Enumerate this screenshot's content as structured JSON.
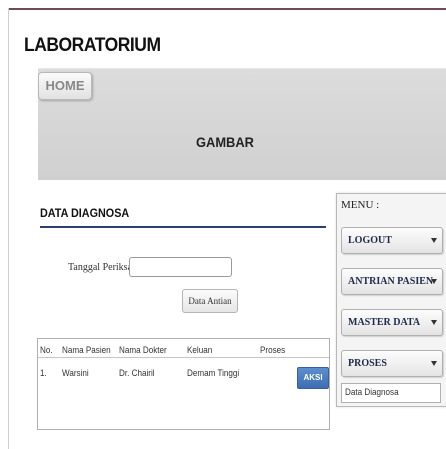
{
  "app": {
    "title": "LABORATORIUM"
  },
  "nav": {
    "home_label": "HOME"
  },
  "banner": {
    "title": "GAMBAR"
  },
  "section": {
    "title": "DATA DIAGNOSA"
  },
  "form": {
    "date_label": "Tanggal Periksa :",
    "date_value": "",
    "data_button": "Data Antian"
  },
  "table": {
    "headers": [
      "No.",
      "Nama Pasien",
      "Nama Dokter",
      "Keluan",
      "Proses"
    ],
    "rows": [
      {
        "no": "1.",
        "nama_pasien": "Warsini",
        "nama_dokter": "Dr. Chairil",
        "keluan": "Demam Tinggi",
        "aksi": "AKSI"
      }
    ]
  },
  "menu": {
    "title": "MENU :",
    "items": [
      {
        "label": "LOGOUT"
      },
      {
        "label": "ANTRIAN PASIEN"
      },
      {
        "label": "MASTER DATA"
      },
      {
        "label": "PROSES"
      }
    ],
    "proses_submenu": [
      {
        "label": "Data Diagnosa"
      }
    ]
  },
  "colors": {
    "accent_line": "#2d3e75",
    "aksi_button": "#4a7cc0",
    "frame_top": "#6d4a5a"
  }
}
